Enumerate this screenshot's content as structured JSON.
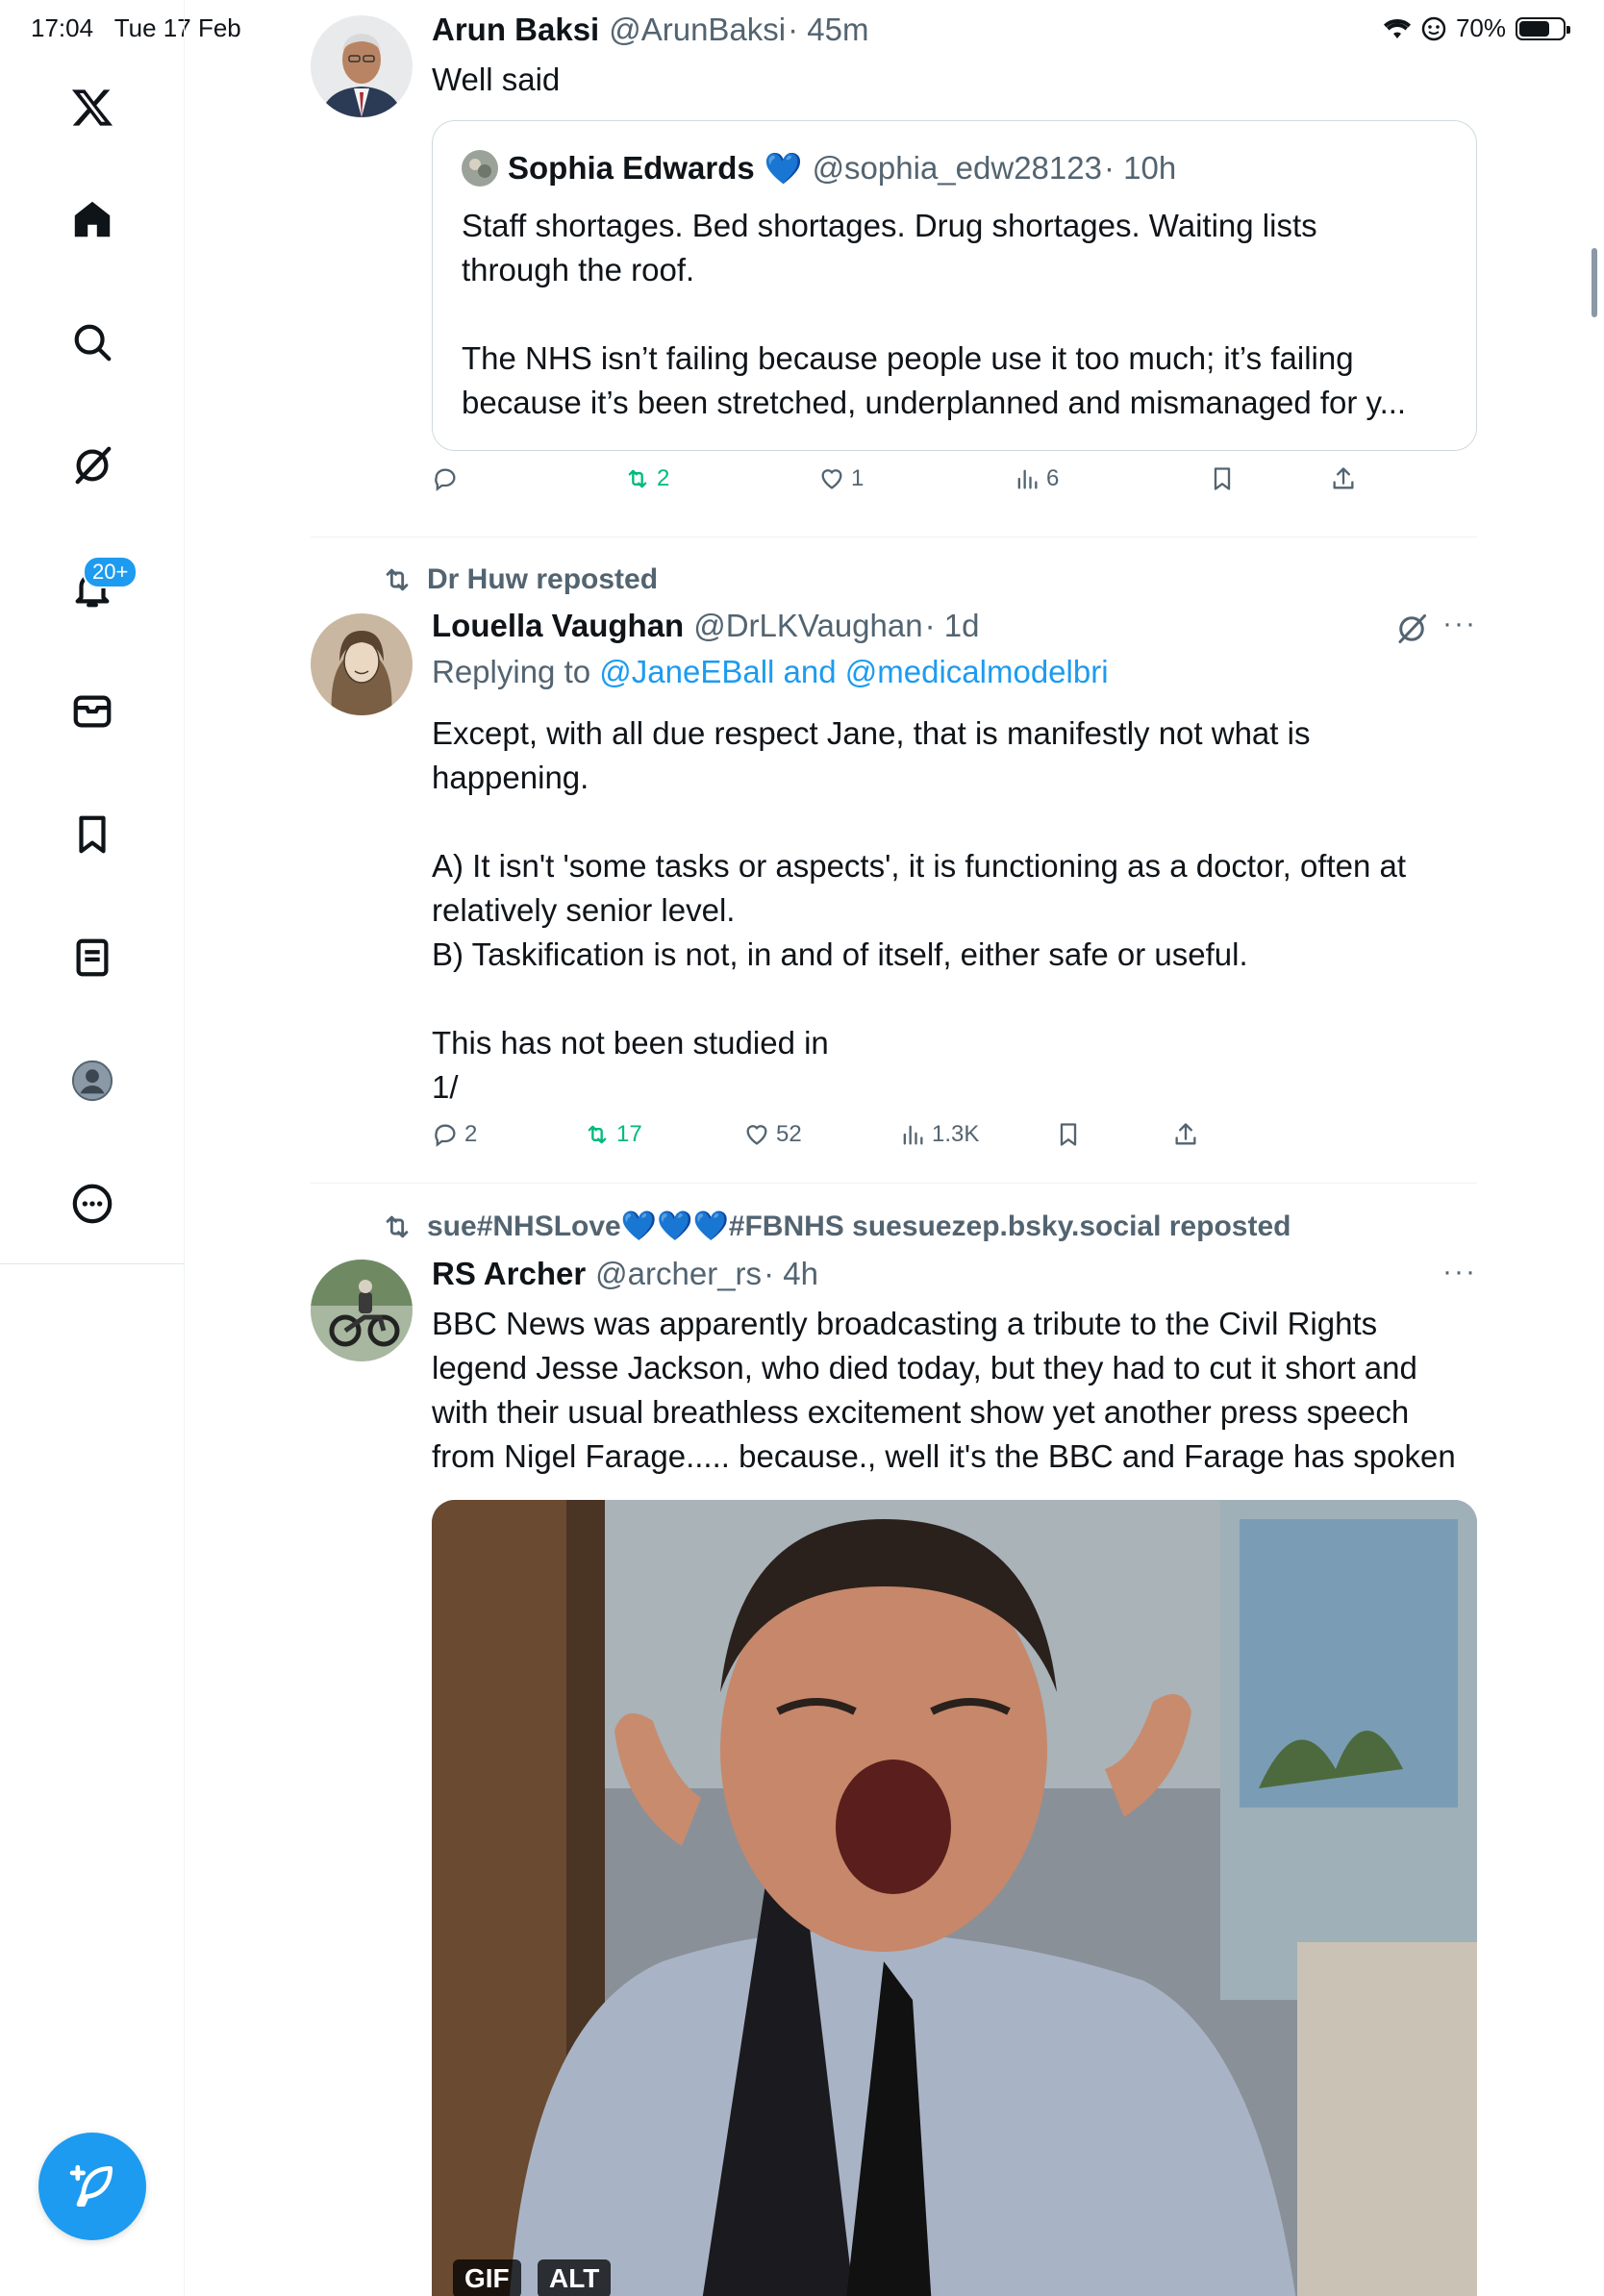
{
  "status_bar": {
    "time": "17:04",
    "date": "Tue 17 Feb",
    "battery": "70%",
    "battery_level": 0.7
  },
  "sidebar": {
    "items": [
      {
        "icon": "x-logo-icon"
      },
      {
        "icon": "home-icon"
      },
      {
        "icon": "search-icon"
      },
      {
        "icon": "grok-icon"
      },
      {
        "icon": "bell-icon",
        "badge": "20+"
      },
      {
        "icon": "mail-icon"
      },
      {
        "icon": "bookmark-icon"
      },
      {
        "icon": "list-icon"
      },
      {
        "icon": "profile-icon"
      },
      {
        "icon": "more-icon"
      }
    ],
    "compose_icon": "compose-icon"
  },
  "posts": [
    {
      "name": "Arun Baksi",
      "handle": "@ArunBaksi",
      "time": "· 45m",
      "text": "Well said",
      "quote": {
        "name": "Sophia Edwards",
        "verified_emoji": "💙",
        "handle": "@sophia_edw28123",
        "time": "· 10h",
        "text_lines": [
          "Staff shortages. Bed shortages. Drug shortages. Waiting lists",
          "through the roof.",
          "",
          "The NHS isn’t failing because people use it too much; it’s failing",
          "because it’s been stretched, underplanned and mismanaged for y..."
        ]
      },
      "stats": {
        "replies": "",
        "reposts": "2",
        "likes": "1",
        "views": "6"
      }
    },
    {
      "reposted_by": "Dr Huw reposted",
      "name": "Louella Vaughan",
      "handle": "@DrLKVaughan",
      "time": "· 1d",
      "replying_prefix": "Replying to",
      "replying_to": "@JaneEBall and @medicalmodelbri",
      "text_lines": [
        "Except, with all due respect Jane, that is manifestly not what is",
        "happening.",
        "",
        "A) It isn't 'some tasks or aspects', it is functioning as a doctor, often at",
        "relatively senior level.",
        "B) Taskification is not, in and of itself, either safe or useful.",
        "",
        "This has not been studied in",
        "1/"
      ],
      "stats": {
        "replies": "2",
        "reposts": "17",
        "likes": "52",
        "views": "1.3K"
      }
    },
    {
      "reposted_by": "sue#NHSLove💙💙💙#FBNHS suesuezep.bsky.social reposted",
      "name": "RS Archer",
      "handle": "@archer_rs",
      "time": "· 4h",
      "text_lines": [
        "BBC News was apparently broadcasting a tribute to the Civil Rights",
        "legend Jesse Jackson, who died today, but they had to cut it short and",
        "with their usual breathless excitement show yet another press speech",
        "from Nigel Farage..... because., well it's the BBC and Farage has spoken"
      ],
      "media_badges": [
        "GIF",
        "ALT"
      ]
    }
  ],
  "colors": {
    "accent": "#1d9bf0",
    "repost_green": "#00ba7c",
    "muted": "#536471"
  }
}
